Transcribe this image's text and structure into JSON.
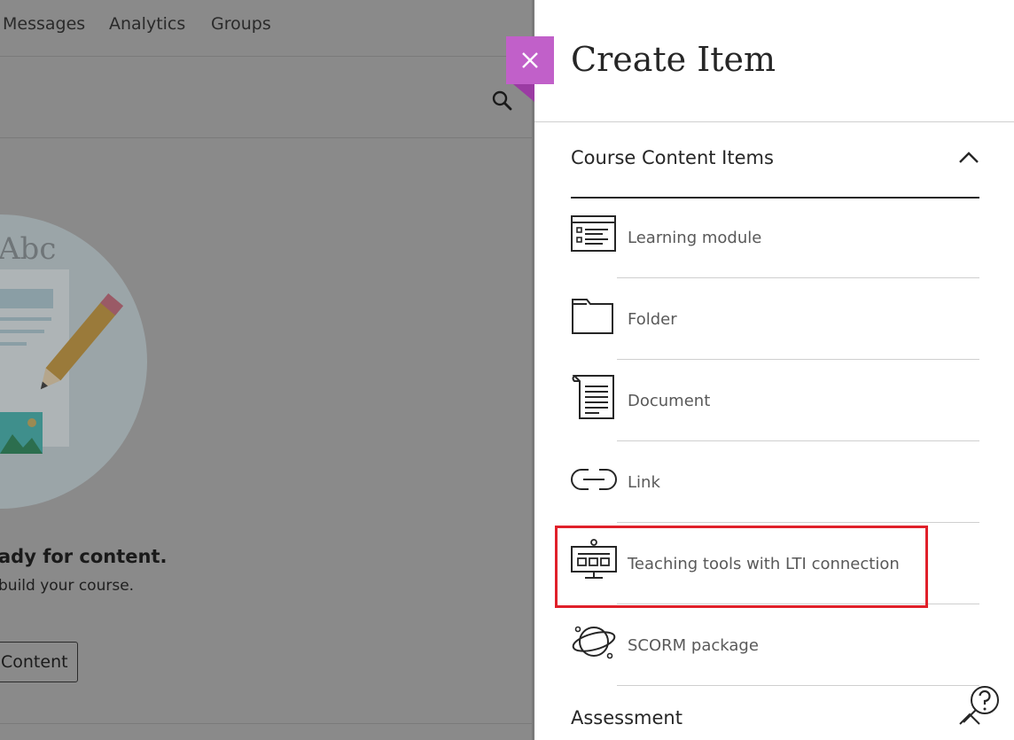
{
  "background": {
    "nav": [
      "Messages",
      "Analytics",
      "Groups"
    ],
    "illustration_text": "Abc",
    "empty_title": "ady for content.",
    "empty_subtitle": "build your course.",
    "add_button_label": "Content"
  },
  "panel": {
    "title": "Create Item",
    "section_title": "Course Content Items",
    "items": [
      {
        "label": "Learning module",
        "icon": "learning-module-icon"
      },
      {
        "label": "Folder",
        "icon": "folder-icon"
      },
      {
        "label": "Document",
        "icon": "document-icon"
      },
      {
        "label": "Link",
        "icon": "link-icon"
      },
      {
        "label": "Teaching tools with LTI connection",
        "icon": "lti-tools-icon"
      },
      {
        "label": "SCORM package",
        "icon": "scorm-package-icon"
      }
    ],
    "next_section_title": "Assessment"
  },
  "colors": {
    "accent": "#c160c9",
    "highlight": "#e0202a",
    "overlay": "#8a8a8a"
  }
}
